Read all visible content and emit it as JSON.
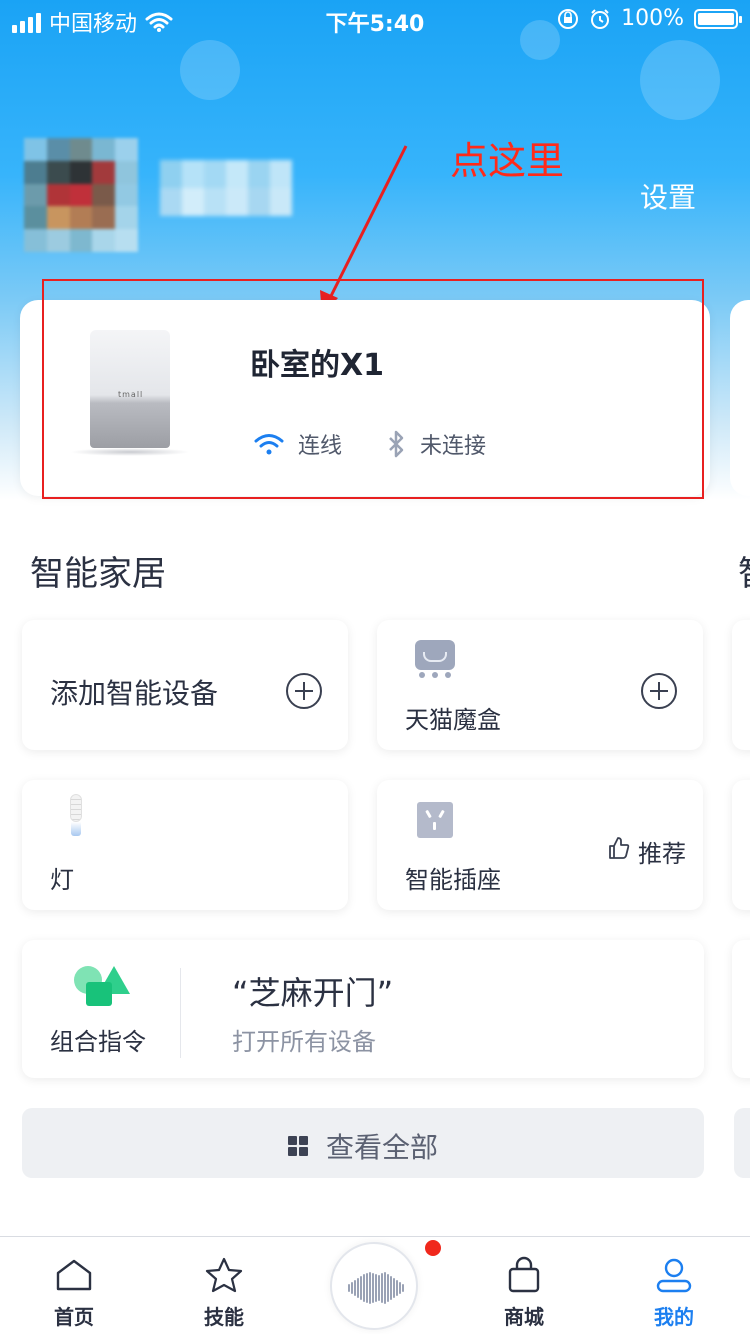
{
  "status_bar": {
    "carrier": "中国移动",
    "time": "下午5:40",
    "battery": "100%",
    "battery_level": 1.0
  },
  "header": {
    "settings_label": "设置",
    "annotation": "点这里"
  },
  "device": {
    "name": "卧室的X1",
    "wifi_label": "连线",
    "bluetooth_label": "未连接",
    "speaker_logo": "tmall"
  },
  "smart_home": {
    "title": "智能家居",
    "title_peek": "智",
    "add_device_label": "添加智能设备",
    "tmall_box_label": "天猫魔盒",
    "light_label": "灯",
    "socket_label": "智能插座",
    "recommend_label": "推荐",
    "combo_label": "组合指令",
    "combo_quote": "“芝麻开门”",
    "combo_sub": "打开所有设备",
    "view_all_label": "查看全部"
  },
  "tabs": [
    {
      "label": "首页",
      "icon": "home-icon",
      "active": false
    },
    {
      "label": "技能",
      "icon": "star-icon",
      "active": false
    },
    {
      "label": "商城",
      "icon": "shopping-bag-icon",
      "active": false
    },
    {
      "label": "我的",
      "icon": "user-icon",
      "active": true
    }
  ],
  "colors": {
    "accent": "#1c7ff0",
    "annotation": "#ff2a1a",
    "notification_dot": "#f0281c"
  }
}
